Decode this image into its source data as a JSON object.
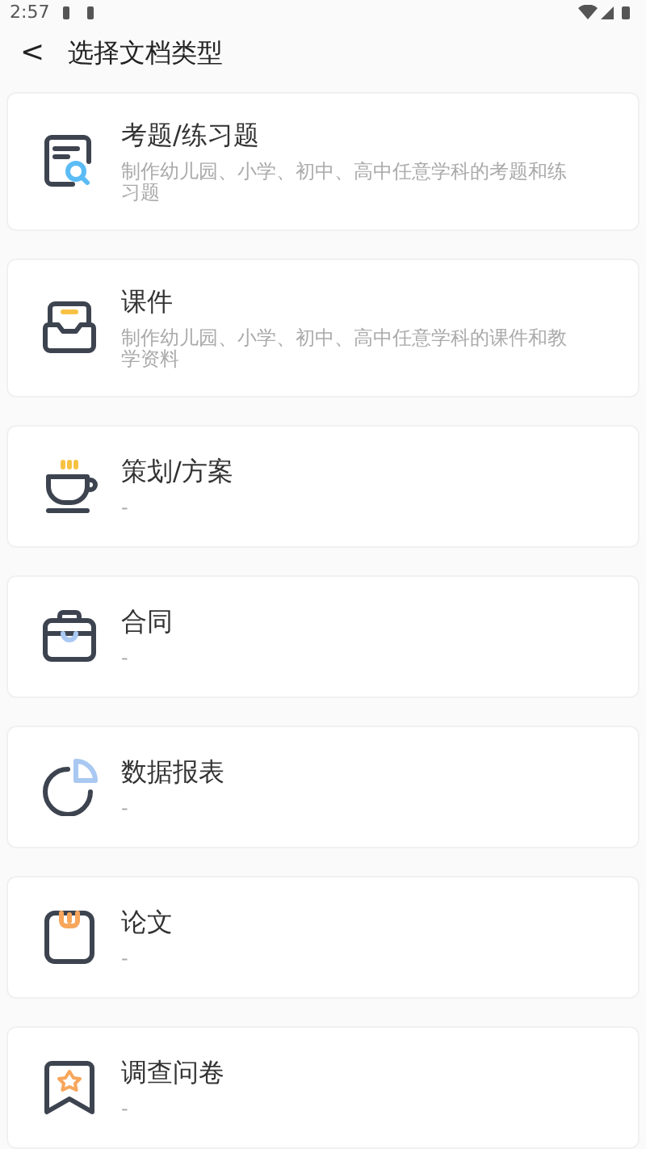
{
  "status_bar": {
    "time": "2:57"
  },
  "header": {
    "back": "<",
    "title": "选择文档类型"
  },
  "items": [
    {
      "kind": "exam",
      "title": "考题/练习题",
      "description": "制作幼儿园、小学、初中、高中任意学科的考题和练习题"
    },
    {
      "kind": "courseware",
      "title": "课件",
      "description": "制作幼儿园、小学、初中、高中任意学科的课件和教学资料"
    },
    {
      "kind": "plan",
      "title": "策划/方案",
      "description": "-"
    },
    {
      "kind": "contract",
      "title": "合同",
      "description": "-"
    },
    {
      "kind": "report",
      "title": "数据报表",
      "description": "-"
    },
    {
      "kind": "paper",
      "title": "论文",
      "description": "-"
    },
    {
      "kind": "survey",
      "title": "调查问卷",
      "description": "-"
    }
  ]
}
